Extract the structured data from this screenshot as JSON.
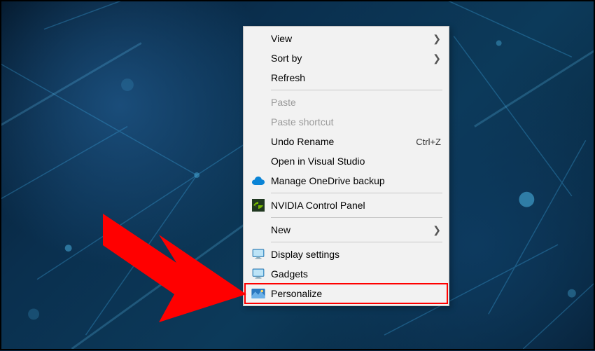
{
  "context_menu": {
    "items": {
      "view": {
        "label": "View"
      },
      "sort_by": {
        "label": "Sort by"
      },
      "refresh": {
        "label": "Refresh"
      },
      "paste": {
        "label": "Paste"
      },
      "paste_shortcut": {
        "label": "Paste shortcut"
      },
      "undo_rename": {
        "label": "Undo Rename",
        "shortcut": "Ctrl+Z"
      },
      "open_vs": {
        "label": "Open in Visual Studio"
      },
      "onedrive": {
        "label": "Manage OneDrive backup"
      },
      "nvidia": {
        "label": "NVIDIA Control Panel"
      },
      "new": {
        "label": "New"
      },
      "display": {
        "label": "Display settings"
      },
      "gadgets": {
        "label": "Gadgets"
      },
      "personalize": {
        "label": "Personalize"
      }
    }
  },
  "highlight": {
    "target": "personalize"
  }
}
